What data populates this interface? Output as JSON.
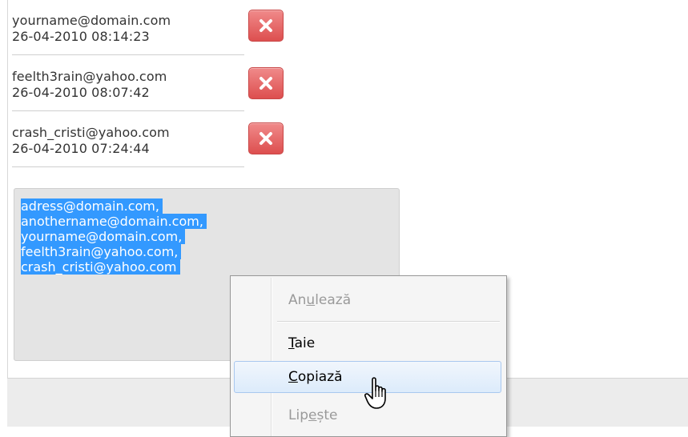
{
  "entries": [
    {
      "email": "yourname@domain.com",
      "date": "26-04-2010 08:14:23"
    },
    {
      "email": "feelth3rain@yahoo.com",
      "date": "26-04-2010 08:07:42"
    },
    {
      "email": "crash_cristi@yahoo.com",
      "date": "26-04-2010 07:24:44"
    }
  ],
  "selected_text_lines": [
    "adress@domain.com,",
    "anothername@domain.com,",
    "yourname@domain.com,",
    "feelth3rain@yahoo.com,",
    "crash_cristi@yahoo.com"
  ],
  "context_menu": {
    "undo": {
      "pre": "An",
      "key": "u",
      "post": "lează"
    },
    "cut": {
      "pre": "",
      "key": "T",
      "post": "aie"
    },
    "copy": {
      "pre": "",
      "key": "C",
      "post": "opiază"
    },
    "paste": {
      "pre": "Lip",
      "key": "e",
      "post": "ște"
    }
  },
  "colors": {
    "selection": "#3399ff",
    "delete_button": "#e05555",
    "menu_hover_border": "#a9c8ef"
  }
}
